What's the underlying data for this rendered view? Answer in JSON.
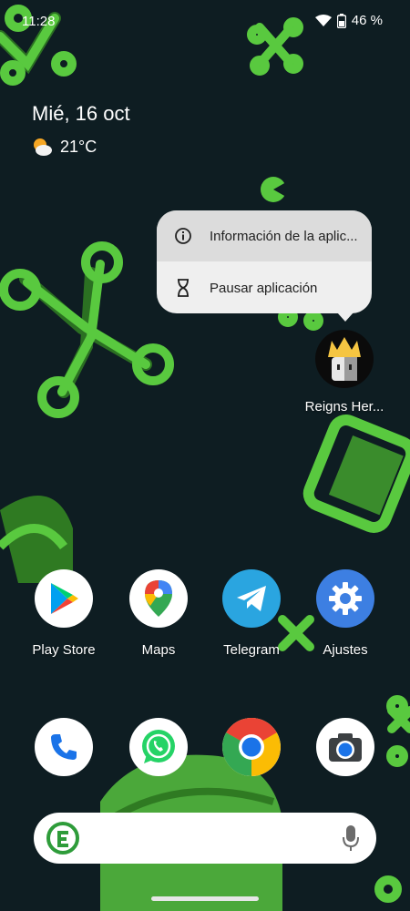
{
  "status": {
    "time": "11:28",
    "battery": "46 %"
  },
  "widget": {
    "date": "Mié, 16 oct",
    "temperature": "21°C"
  },
  "context_menu": {
    "items": [
      {
        "label": "Información de la aplic...",
        "icon": "info-icon"
      },
      {
        "label": "Pausar aplicación",
        "icon": "hourglass-icon"
      }
    ]
  },
  "app_selected": {
    "label": "Reigns Her..."
  },
  "apps": {
    "play_store": "Play Store",
    "maps": "Maps",
    "telegram": "Telegram",
    "ajustes": "Ajustes"
  },
  "colors": {
    "background": "#0e1d22",
    "wallpaper_green": "#4bc43a",
    "popup": "#efefef",
    "telegram": "#2aa5e0",
    "settings": "#3d7fe2",
    "whatsapp": "#25d366"
  }
}
